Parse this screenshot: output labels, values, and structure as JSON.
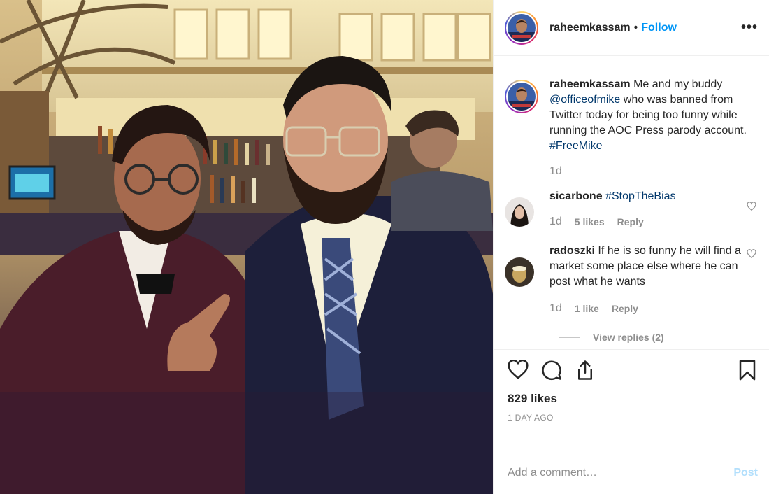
{
  "post": {
    "username": "raheemkassam",
    "separator": "•",
    "follow_label": "Follow",
    "more_label": "•••",
    "photo_icon": "photo",
    "caption": {
      "username": "raheemkassam",
      "text_1": "Me and my buddy",
      "mention": "@officeofmike",
      "text_2": "who was banned from Twitter today for being too funny while running the AOC Press parody account.",
      "hashtag": "#FreeMike",
      "time": "1d"
    },
    "comments": [
      {
        "username": "sicarbone",
        "hashtag": "#StopTheBias",
        "text": "",
        "time": "1d",
        "likes": "5 likes",
        "reply_label": "Reply"
      },
      {
        "username": "radoszki",
        "text": "If he is so funny he will find a market some place else where he can post what he wants",
        "time": "1d",
        "likes": "1 like",
        "reply_label": "Reply",
        "view_replies": "View replies (2)"
      }
    ],
    "like_count": "829 likes",
    "posted_ago": "1 DAY AGO",
    "add_comment_placeholder": "Add a comment…",
    "post_label": "Post"
  },
  "colors": {
    "accent": "#0095f6",
    "post_disabled": "#b2dffc",
    "muted": "#8e8e8e",
    "link": "#00376b"
  },
  "icons": [
    "heart-icon",
    "comment-icon",
    "share-icon",
    "bookmark-icon",
    "more-icon"
  ]
}
